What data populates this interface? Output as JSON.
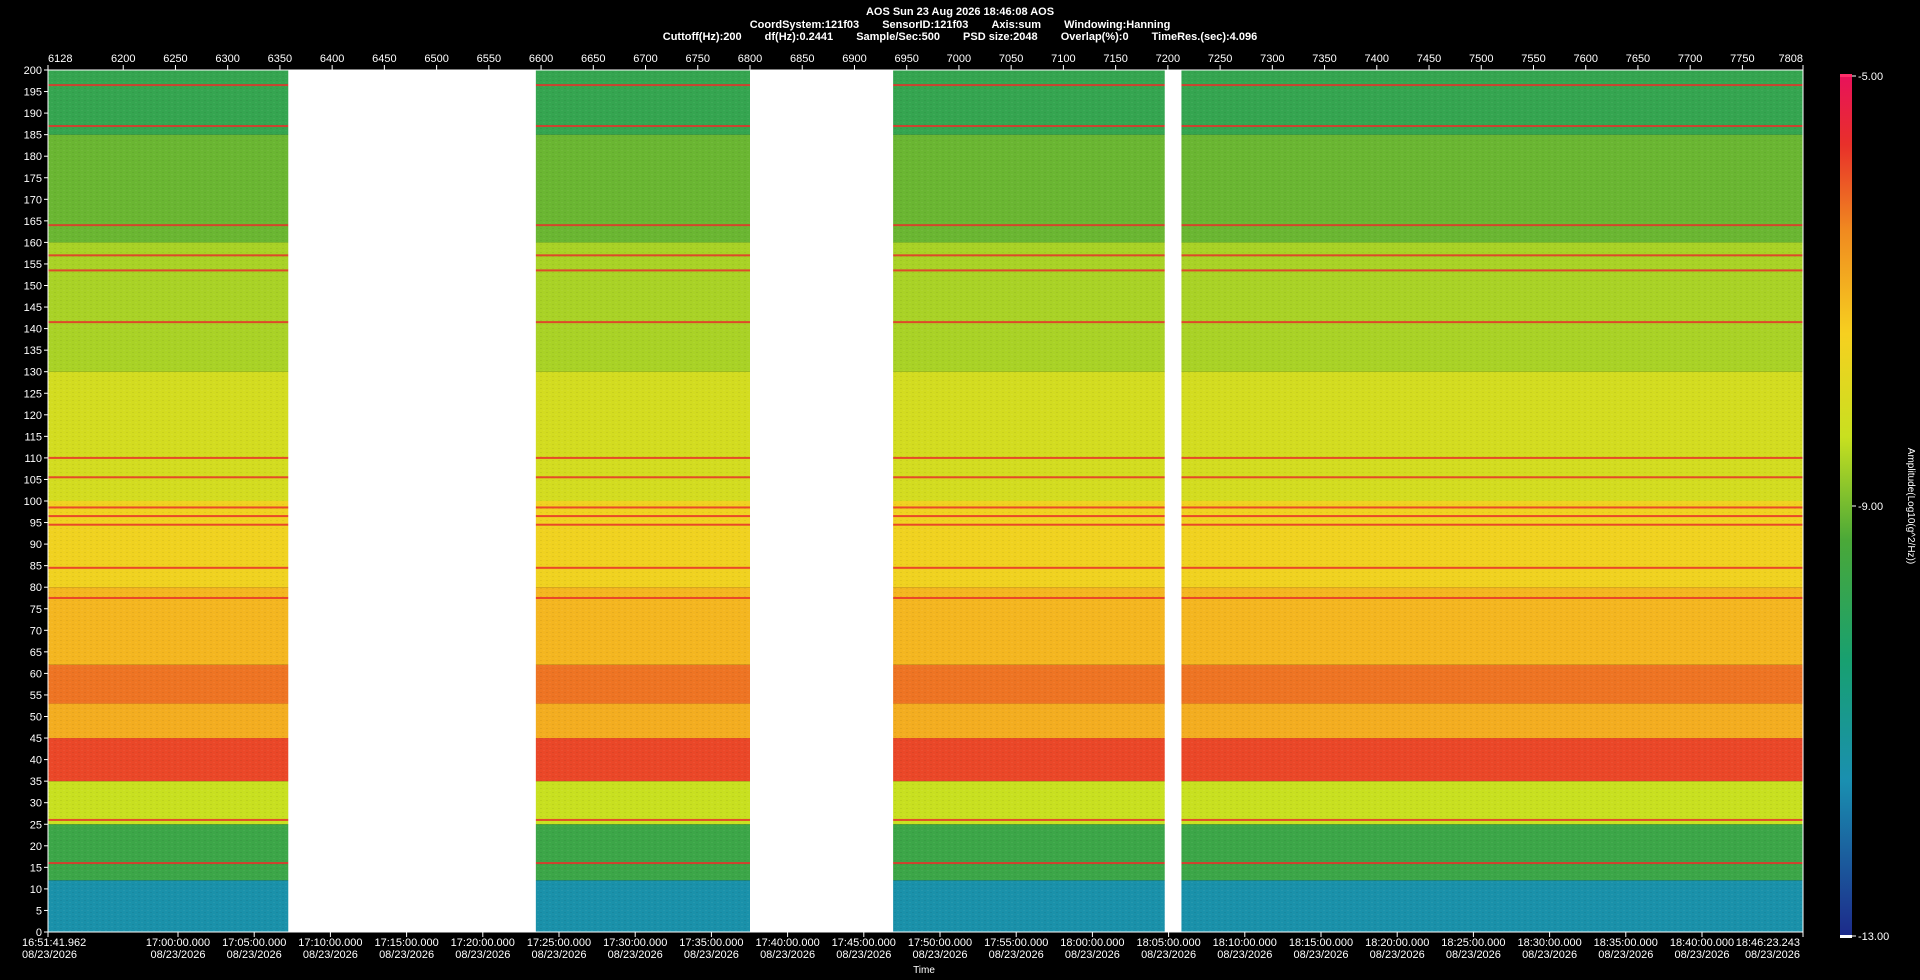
{
  "header": {
    "line1": "AOS   Sun 23 Aug 2026 18:46:08   AOS",
    "line2": [
      "CoordSystem:121f03",
      "SensorID:121f03",
      "Axis:sum",
      "Windowing:Hanning"
    ],
    "line3": [
      "Cuttoff(Hz):200",
      "df(Hz):0.2441",
      "Sample/Sec:500",
      "PSD size:2048",
      "Overlap(%):0",
      "TimeRes.(sec):4.096"
    ]
  },
  "colors": {
    "background": "#000000",
    "gap": "#ffffff",
    "low": "#1c3d8f",
    "mid": "#c8e020",
    "high": "#e8123a",
    "peak": "#ff1f8a"
  },
  "chart_data": {
    "type": "heatmap",
    "xlabel": "Time",
    "ylabel": "",
    "colorbar_label": "Amplitude(Log10(g^2/Hz))",
    "colorbar_ticks": [
      "-5.00",
      "-9.00",
      "-13.00"
    ],
    "colorbar_range": [
      -13,
      -5
    ],
    "ylim": [
      0,
      200
    ],
    "y_ticks": [
      0,
      5,
      10,
      15,
      20,
      25,
      30,
      35,
      40,
      45,
      50,
      55,
      60,
      65,
      70,
      75,
      80,
      85,
      90,
      95,
      100,
      105,
      110,
      115,
      120,
      125,
      130,
      135,
      140,
      145,
      150,
      155,
      160,
      165,
      170,
      175,
      180,
      185,
      190,
      195,
      200
    ],
    "top_axis_range": [
      6128,
      7808
    ],
    "top_axis_ticks": [
      "6128",
      "6200",
      "6250",
      "6300",
      "6350",
      "6400",
      "6450",
      "6500",
      "6550",
      "6600",
      "6650",
      "6700",
      "6750",
      "6800",
      "6850",
      "6900",
      "6950",
      "7000",
      "7050",
      "7100",
      "7150",
      "7200",
      "7250",
      "7300",
      "7350",
      "7400",
      "7450",
      "7500",
      "7550",
      "7600",
      "7650",
      "7700",
      "7750",
      "7808"
    ],
    "time_ticks": [
      {
        "time": "16:51:41.962",
        "date": "08/23/2026"
      },
      {
        "time": "17:00:00.000",
        "date": "08/23/2026"
      },
      {
        "time": "17:05:00.000",
        "date": "08/23/2026"
      },
      {
        "time": "17:10:00.000",
        "date": "08/23/2026"
      },
      {
        "time": "17:15:00.000",
        "date": "08/23/2026"
      },
      {
        "time": "17:20:00.000",
        "date": "08/23/2026"
      },
      {
        "time": "17:25:00.000",
        "date": "08/23/2026"
      },
      {
        "time": "17:30:00.000",
        "date": "08/23/2026"
      },
      {
        "time": "17:35:00.000",
        "date": "08/23/2026"
      },
      {
        "time": "17:40:00.000",
        "date": "08/23/2026"
      },
      {
        "time": "17:45:00.000",
        "date": "08/23/2026"
      },
      {
        "time": "17:50:00.000",
        "date": "08/23/2026"
      },
      {
        "time": "17:55:00.000",
        "date": "08/23/2026"
      },
      {
        "time": "18:00:00.000",
        "date": "08/23/2026"
      },
      {
        "time": "18:05:00.000",
        "date": "08/23/2026"
      },
      {
        "time": "18:10:00.000",
        "date": "08/23/2026"
      },
      {
        "time": "18:15:00.000",
        "date": "08/23/2026"
      },
      {
        "time": "18:20:00.000",
        "date": "08/23/2026"
      },
      {
        "time": "18:25:00.000",
        "date": "08/23/2026"
      },
      {
        "time": "18:30:00.000",
        "date": "08/23/2026"
      },
      {
        "time": "18:35:00.000",
        "date": "08/23/2026"
      },
      {
        "time": "18:40:00.000",
        "date": "08/23/2026"
      },
      {
        "time": "18:46:23.243",
        "date": "08/23/2026"
      }
    ],
    "data_gaps": [
      [
        6358,
        6595
      ],
      [
        6800,
        6937
      ],
      [
        7197,
        7213
      ]
    ],
    "frequency_bands": [
      {
        "hz": [
          0,
          12
        ],
        "level": -11.5
      },
      {
        "hz": [
          12,
          25
        ],
        "level": -10.0
      },
      {
        "hz": [
          25,
          35
        ],
        "level": -9.0
      },
      {
        "hz": [
          35,
          45
        ],
        "level": -6.8
      },
      {
        "hz": [
          45,
          53
        ],
        "level": -7.8
      },
      {
        "hz": [
          53,
          62
        ],
        "level": -7.2
      },
      {
        "hz": [
          62,
          80
        ],
        "level": -7.9
      },
      {
        "hz": [
          80,
          100
        ],
        "level": -8.3
      },
      {
        "hz": [
          100,
          130
        ],
        "level": -8.8
      },
      {
        "hz": [
          130,
          160
        ],
        "level": -9.2
      },
      {
        "hz": [
          160,
          185
        ],
        "level": -9.6
      },
      {
        "hz": [
          185,
          200
        ],
        "level": -10.1
      }
    ],
    "tonal_lines_hz": [
      196.5,
      187,
      164,
      157,
      153.5,
      141.5,
      110,
      105.5,
      98.5,
      96.5,
      94.5,
      84.5,
      77.5,
      26,
      16
    ]
  }
}
